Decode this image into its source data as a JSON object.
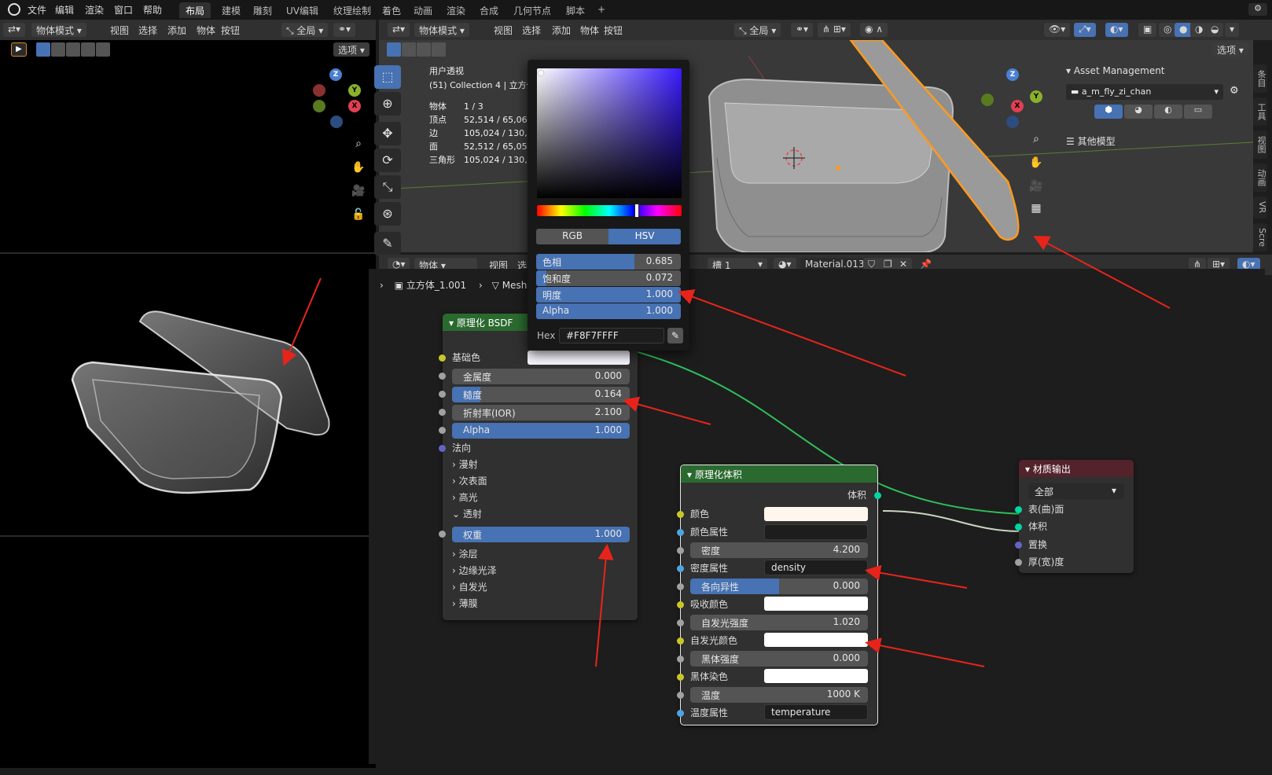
{
  "menubar": {
    "items": [
      "文件",
      "编辑",
      "渲染",
      "窗口",
      "帮助"
    ],
    "workspaces": [
      "布局",
      "建模",
      "雕刻",
      "UV编辑",
      "纹理绘制",
      "着色",
      "动画",
      "渲染",
      "合成",
      "几何节点",
      "脚本"
    ],
    "active_workspace": "布局",
    "add_tab": "+"
  },
  "left_viewport": {
    "mode": "物体模式",
    "menu": [
      "视图",
      "选择",
      "添加",
      "物体",
      "按钮"
    ],
    "orientation": "全局",
    "options": "选项"
  },
  "main_viewport": {
    "mode": "物体模式",
    "menu": [
      "视图",
      "选择",
      "添加",
      "物体",
      "按钮"
    ],
    "orientation": "全局",
    "options": "选项",
    "overlay_title": "用户透视",
    "overlay_collection": "(51) Collection 4 | 立方体",
    "stats": [
      {
        "label": "物体",
        "value": "1 / 3"
      },
      {
        "label": "顶点",
        "value": "52,514 / 65,060"
      },
      {
        "label": "边",
        "value": "105,024 / 130,1"
      },
      {
        "label": "面",
        "value": "52,512 / 65,056"
      },
      {
        "label": "三角形",
        "value": "105,024 / 130,1"
      }
    ],
    "asset_panel_title": "Asset Management",
    "asset_library": "a_m_fly_zi_chan",
    "asset_other": "其他模型",
    "side_tabs": [
      "条目",
      "工具",
      "视图",
      "动画",
      "VR",
      "Scre"
    ]
  },
  "node_editor": {
    "header_mode": "物体",
    "header_menu": [
      "视图",
      "选"
    ],
    "slot": "槽 1",
    "material": "Material.013",
    "breadcrumb_object": "立方体_1.001",
    "breadcrumb_mesh": "Mesh",
    "bsdf": {
      "title": "原理化 BSDF",
      "base_color_label": "基础色",
      "metallic_label": "金属度",
      "metallic": "0.000",
      "roughness_label": "糙度",
      "roughness": "0.164",
      "ior_label": "折射率(IOR)",
      "ior": "2.100",
      "alpha_label": "Alpha",
      "alpha": "1.000",
      "normal_label": "法向",
      "sections": [
        "漫射",
        "次表面",
        "高光"
      ],
      "transmission_label": "透射",
      "weight_label": "权重",
      "weight": "1.000",
      "sections2": [
        "涂层",
        "边缘光泽",
        "自发光",
        "薄膜"
      ]
    },
    "volume": {
      "title": "原理化体积",
      "output_label": "体积",
      "color_label": "颜色",
      "color_attr_label": "颜色属性",
      "density_label": "密度",
      "density": "4.200",
      "density_attr_label": "密度属性",
      "density_attr": "density",
      "anisotropy_label": "各向异性",
      "anisotropy": "0.000",
      "absorption_label": "吸收颜色",
      "emission_strength_label": "自发光强度",
      "emission_strength": "1.020",
      "emission_color_label": "自发光颜色",
      "blackbody_label": "黑体强度",
      "blackbody": "0.000",
      "blackbody_tint_label": "黑体染色",
      "temperature_label": "温度",
      "temperature": "1000 K",
      "temperature_attr_label": "温度属性",
      "temperature_attr": "temperature"
    },
    "output": {
      "title": "材质输出",
      "target": "全部",
      "inputs": [
        "表(曲)面",
        "体积",
        "置换",
        "厚(宽)度"
      ]
    }
  },
  "color_picker": {
    "tab_rgb": "RGB",
    "tab_hsv": "HSV",
    "active_tab": "HSV",
    "hue_label": "色相",
    "hue": "0.685",
    "saturation_label": "饱和度",
    "saturation": "0.072",
    "value_label": "明度",
    "value": "1.000",
    "alpha_label": "Alpha",
    "alpha": "1.000",
    "hex_label": "Hex",
    "hex": "#F8F7FFFF"
  },
  "colors": {
    "accent": "#4772b3",
    "node_header_green": "#2a6a2f",
    "output_header": "#53222b",
    "annotation_red": "#e8241a"
  }
}
